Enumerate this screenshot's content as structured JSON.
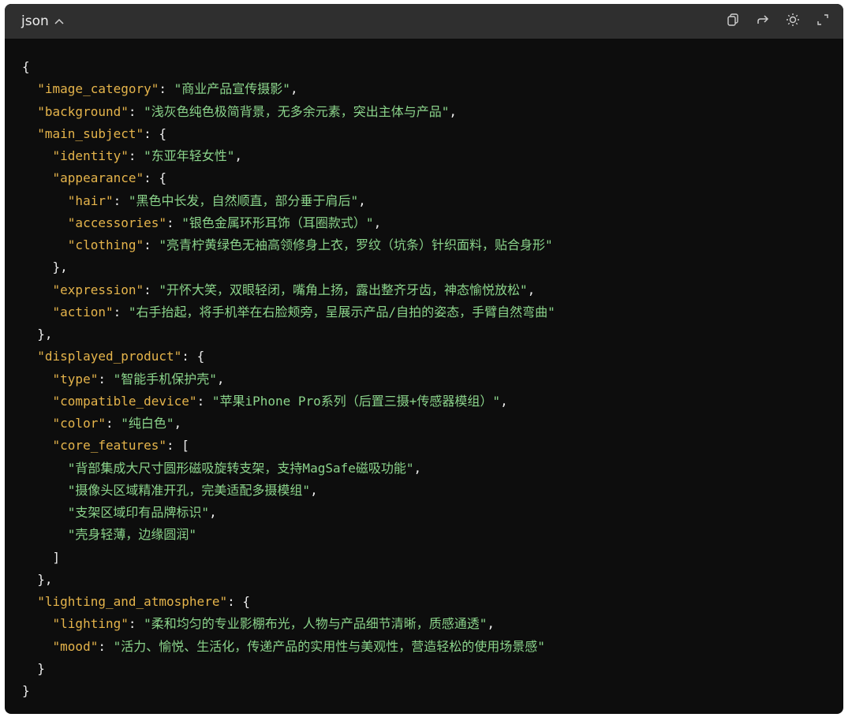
{
  "header": {
    "language": "json",
    "icons": [
      "copy-icon",
      "share-icon",
      "theme-icon",
      "expand-icon"
    ]
  },
  "code_lines": [
    [
      {
        "t": "p",
        "v": "{"
      }
    ],
    [
      {
        "t": "p",
        "v": "  "
      },
      {
        "t": "k",
        "v": "\"image_category\""
      },
      {
        "t": "p",
        "v": ": "
      },
      {
        "t": "s",
        "v": "\"商业产品宣传摄影\""
      },
      {
        "t": "p",
        "v": ","
      }
    ],
    [
      {
        "t": "p",
        "v": "  "
      },
      {
        "t": "k",
        "v": "\"background\""
      },
      {
        "t": "p",
        "v": ": "
      },
      {
        "t": "s",
        "v": "\"浅灰色纯色极简背景，无多余元素，突出主体与产品\""
      },
      {
        "t": "p",
        "v": ","
      }
    ],
    [
      {
        "t": "p",
        "v": "  "
      },
      {
        "t": "k",
        "v": "\"main_subject\""
      },
      {
        "t": "p",
        "v": ": {"
      }
    ],
    [
      {
        "t": "p",
        "v": "    "
      },
      {
        "t": "k",
        "v": "\"identity\""
      },
      {
        "t": "p",
        "v": ": "
      },
      {
        "t": "s",
        "v": "\"东亚年轻女性\""
      },
      {
        "t": "p",
        "v": ","
      }
    ],
    [
      {
        "t": "p",
        "v": "    "
      },
      {
        "t": "k",
        "v": "\"appearance\""
      },
      {
        "t": "p",
        "v": ": {"
      }
    ],
    [
      {
        "t": "p",
        "v": "      "
      },
      {
        "t": "k",
        "v": "\"hair\""
      },
      {
        "t": "p",
        "v": ": "
      },
      {
        "t": "s",
        "v": "\"黑色中长发，自然顺直，部分垂于肩后\""
      },
      {
        "t": "p",
        "v": ","
      }
    ],
    [
      {
        "t": "p",
        "v": "      "
      },
      {
        "t": "k",
        "v": "\"accessories\""
      },
      {
        "t": "p",
        "v": ": "
      },
      {
        "t": "s",
        "v": "\"银色金属环形耳饰（耳圈款式）\""
      },
      {
        "t": "p",
        "v": ","
      }
    ],
    [
      {
        "t": "p",
        "v": "      "
      },
      {
        "t": "k",
        "v": "\"clothing\""
      },
      {
        "t": "p",
        "v": ": "
      },
      {
        "t": "s",
        "v": "\"亮青柠黄绿色无袖高领修身上衣，罗纹（坑条）针织面料，贴合身形\""
      }
    ],
    [
      {
        "t": "p",
        "v": "    },"
      }
    ],
    [
      {
        "t": "p",
        "v": "    "
      },
      {
        "t": "k",
        "v": "\"expression\""
      },
      {
        "t": "p",
        "v": ": "
      },
      {
        "t": "s",
        "v": "\"开怀大笑，双眼轻闭，嘴角上扬，露出整齐牙齿，神态愉悦放松\""
      },
      {
        "t": "p",
        "v": ","
      }
    ],
    [
      {
        "t": "p",
        "v": "    "
      },
      {
        "t": "k",
        "v": "\"action\""
      },
      {
        "t": "p",
        "v": ": "
      },
      {
        "t": "s",
        "v": "\"右手抬起，将手机举在右脸颊旁，呈展示产品/自拍的姿态，手臂自然弯曲\""
      }
    ],
    [
      {
        "t": "p",
        "v": "  },"
      }
    ],
    [
      {
        "t": "p",
        "v": "  "
      },
      {
        "t": "k",
        "v": "\"displayed_product\""
      },
      {
        "t": "p",
        "v": ": {"
      }
    ],
    [
      {
        "t": "p",
        "v": "    "
      },
      {
        "t": "k",
        "v": "\"type\""
      },
      {
        "t": "p",
        "v": ": "
      },
      {
        "t": "s",
        "v": "\"智能手机保护壳\""
      },
      {
        "t": "p",
        "v": ","
      }
    ],
    [
      {
        "t": "p",
        "v": "    "
      },
      {
        "t": "k",
        "v": "\"compatible_device\""
      },
      {
        "t": "p",
        "v": ": "
      },
      {
        "t": "s",
        "v": "\"苹果iPhone Pro系列（后置三摄+传感器模组）\""
      },
      {
        "t": "p",
        "v": ","
      }
    ],
    [
      {
        "t": "p",
        "v": "    "
      },
      {
        "t": "k",
        "v": "\"color\""
      },
      {
        "t": "p",
        "v": ": "
      },
      {
        "t": "s",
        "v": "\"纯白色\""
      },
      {
        "t": "p",
        "v": ","
      }
    ],
    [
      {
        "t": "p",
        "v": "    "
      },
      {
        "t": "k",
        "v": "\"core_features\""
      },
      {
        "t": "p",
        "v": ": ["
      }
    ],
    [
      {
        "t": "p",
        "v": "      "
      },
      {
        "t": "s",
        "v": "\"背部集成大尺寸圆形磁吸旋转支架，支持MagSafe磁吸功能\""
      },
      {
        "t": "p",
        "v": ","
      }
    ],
    [
      {
        "t": "p",
        "v": "      "
      },
      {
        "t": "s",
        "v": "\"摄像头区域精准开孔，完美适配多摄模组\""
      },
      {
        "t": "p",
        "v": ","
      }
    ],
    [
      {
        "t": "p",
        "v": "      "
      },
      {
        "t": "s",
        "v": "\"支架区域印有品牌标识\""
      },
      {
        "t": "p",
        "v": ","
      }
    ],
    [
      {
        "t": "p",
        "v": "      "
      },
      {
        "t": "s",
        "v": "\"壳身轻薄，边缘圆润\""
      }
    ],
    [
      {
        "t": "p",
        "v": "    ]"
      }
    ],
    [
      {
        "t": "p",
        "v": "  },"
      }
    ],
    [
      {
        "t": "p",
        "v": "  "
      },
      {
        "t": "k",
        "v": "\"lighting_and_atmosphere\""
      },
      {
        "t": "p",
        "v": ": {"
      }
    ],
    [
      {
        "t": "p",
        "v": "    "
      },
      {
        "t": "k",
        "v": "\"lighting\""
      },
      {
        "t": "p",
        "v": ": "
      },
      {
        "t": "s",
        "v": "\"柔和均匀的专业影棚布光，人物与产品细节清晰，质感通透\""
      },
      {
        "t": "p",
        "v": ","
      }
    ],
    [
      {
        "t": "p",
        "v": "    "
      },
      {
        "t": "k",
        "v": "\"mood\""
      },
      {
        "t": "p",
        "v": ": "
      },
      {
        "t": "s",
        "v": "\"活力、愉悦、生活化，传递产品的实用性与美观性，营造轻松的使用场景感\""
      }
    ],
    [
      {
        "t": "p",
        "v": "  }"
      }
    ],
    [
      {
        "t": "p",
        "v": "}"
      }
    ]
  ]
}
